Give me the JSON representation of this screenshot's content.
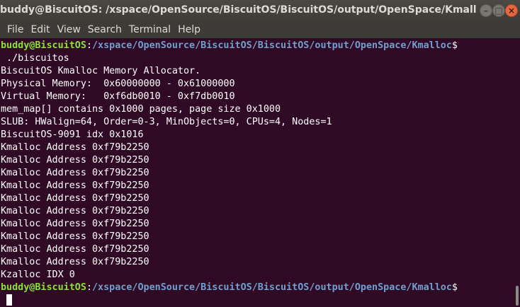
{
  "window": {
    "title": "buddy@BiscuitOS: /xspace/OpenSource/BiscuitOS/BiscuitOS/output/OpenSpace/Kmalloc",
    "minimize_icon": "minimize-icon",
    "maximize_icon": "maximize-icon",
    "close_icon": "close-icon"
  },
  "menu": {
    "file": "File",
    "edit": "Edit",
    "view": "View",
    "search": "Search",
    "terminal": "Terminal",
    "help": "Help"
  },
  "terminal": {
    "prompt1": {
      "user": "buddy@BiscuitOS",
      "sep": ":",
      "path": "/xspace/OpenSource/BiscuitOS/BiscuitOS/output/OpenSpace/Kmalloc",
      "symbol": "$"
    },
    "command": " ./biscuitos",
    "output": [
      "BiscuitOS Kmalloc Memory Allocator.",
      "Physical Memory:  0x60000000 - 0x61000000",
      "Virtual Memory:   0xf6db0010 - 0xf7db0010",
      "mem_map[] contains 0x1000 pages, page size 0x1000",
      "SLUB: HWalign=64, Order=0-3, MinObjects=0, CPUs=4, Nodes=1",
      "BiscuitOS-9091 idx 0x1016",
      "Kmalloc Address 0xf79b2250",
      "Kmalloc Address 0xf79b2250",
      "Kmalloc Address 0xf79b2250",
      "Kmalloc Address 0xf79b2250",
      "Kmalloc Address 0xf79b2250",
      "Kmalloc Address 0xf79b2250",
      "Kmalloc Address 0xf79b2250",
      "Kmalloc Address 0xf79b2250",
      "Kmalloc Address 0xf79b2250",
      "Kmalloc Address 0xf79b2250",
      "Kzalloc IDX 0"
    ],
    "prompt2": {
      "user": "buddy@BiscuitOS",
      "sep": ":",
      "path": "/xspace/OpenSource/BiscuitOS/BiscuitOS/output/OpenSpace/Kmalloc",
      "symbol": "$"
    }
  },
  "colors": {
    "background": "#300a24",
    "user": "#8ae234",
    "path": "#729fcf",
    "text": "#ffffff"
  }
}
